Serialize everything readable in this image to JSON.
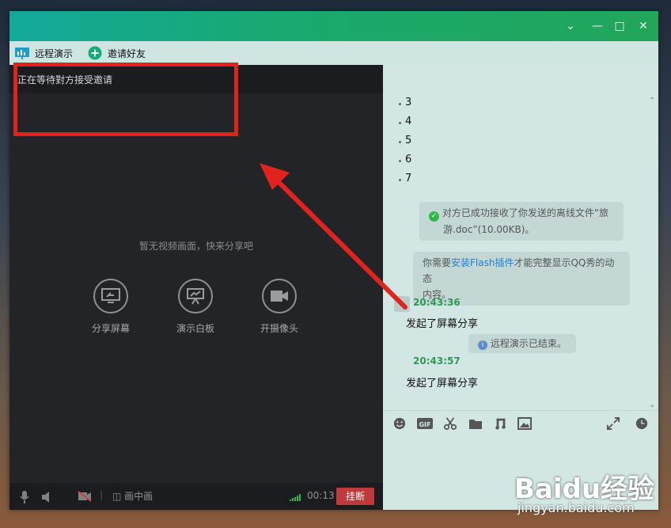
{
  "toolbar": {
    "remote_demo": "远程演示",
    "invite_friends": "邀请好友"
  },
  "left_panel": {
    "status": "正在等待對方接受邀请",
    "no_video": "暂无视频画面，快来分享吧",
    "actions": [
      {
        "label": "分享屏幕",
        "icon": "share-screen-icon"
      },
      {
        "label": "演示白板",
        "icon": "whiteboard-icon"
      },
      {
        "label": "开摄像头",
        "icon": "camera-icon"
      }
    ],
    "bottom": {
      "pip": "画中画",
      "timer": "00:13",
      "hangup": "挂断"
    }
  },
  "chat": {
    "numbers": [
      "3",
      "4",
      "5",
      "6",
      "7"
    ],
    "file_received_1": "对方已成功接收了你发送的离线文件“旅",
    "file_received_2": "游.doc”(10.00KB)。",
    "flash_prefix": "你需要",
    "flash_link": "安装Flash插件",
    "flash_suffix": "才能完整显示QQ秀的动态",
    "flash_line2": "内容。",
    "time1": "20:43:36",
    "msg1": "发起了屏幕分享",
    "demo_ended": "远程演示已结束。",
    "time2": "20:43:57",
    "msg2": "发起了屏幕分享"
  },
  "watermark": {
    "logo": "Baidu经验",
    "sub": "jingyan.baidu.com"
  },
  "colors": {
    "titlebar": "#1aa96e",
    "annotation": "#e0231c",
    "hangup": "#c0393b",
    "time": "#2f9a55",
    "link": "#1a7fd0"
  }
}
